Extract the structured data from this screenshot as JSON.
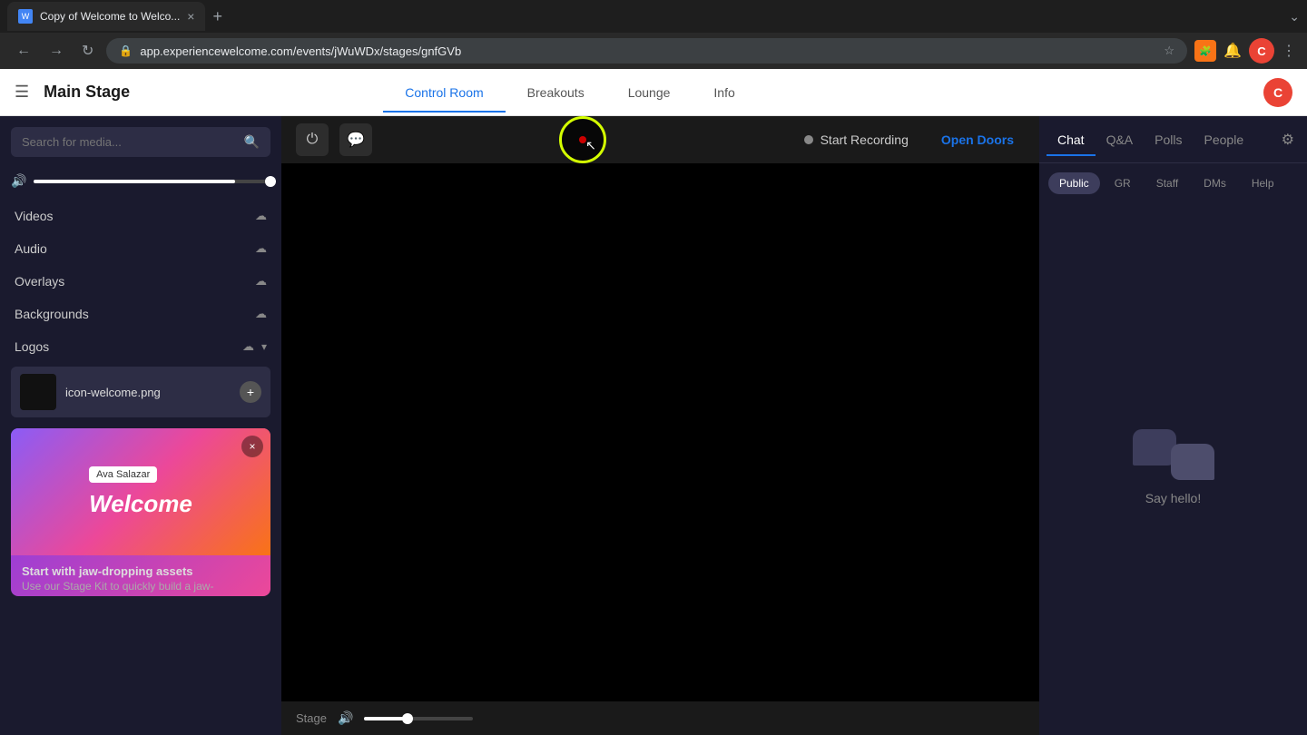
{
  "browser": {
    "tab_title": "Copy of Welcome to Welco...",
    "url": "app.experiencewelcome.com/events/jWuWDx/stages/gnfGVb",
    "new_tab_label": "+",
    "profile_letter": "C"
  },
  "app": {
    "title": "Main Stage",
    "nav": [
      {
        "label": "Control Room",
        "active": true
      },
      {
        "label": "Breakouts",
        "active": false
      },
      {
        "label": "Lounge",
        "active": false
      },
      {
        "label": "Info",
        "active": false
      }
    ],
    "user_letter": "C"
  },
  "sidebar": {
    "search_placeholder": "Search for media...",
    "sections": [
      {
        "label": "Videos",
        "icon": "▶"
      },
      {
        "label": "Audio",
        "icon": "♪"
      },
      {
        "label": "Overlays",
        "icon": "⧉"
      },
      {
        "label": "Backgrounds",
        "icon": "▣"
      },
      {
        "label": "Logos",
        "icon": "L",
        "has_chevron": true
      }
    ],
    "logo_item": {
      "name": "icon-welcome.png",
      "add_label": "+"
    },
    "featured_card": {
      "name_tag": "Ava Salazar",
      "welcome_text": "Welcome",
      "close_label": "×",
      "promo_title": "Start with jaw-dropping assets",
      "promo_desc": "Use our Stage Kit to quickly build a jaw-"
    }
  },
  "stage": {
    "record_label": "Start Recording",
    "open_doors_label": "Open Doors",
    "stage_label": "Stage"
  },
  "chat": {
    "tabs": [
      {
        "label": "Chat",
        "active": true
      },
      {
        "label": "Q&A",
        "active": false
      },
      {
        "label": "Polls",
        "active": false
      },
      {
        "label": "People",
        "active": false
      }
    ],
    "filter_tabs": [
      {
        "label": "Public",
        "active": true
      },
      {
        "label": "GR",
        "active": false
      },
      {
        "label": "Staff",
        "active": false
      },
      {
        "label": "DMs",
        "active": false
      },
      {
        "label": "Help",
        "active": false
      }
    ],
    "say_hello_text": "Say hello!"
  }
}
